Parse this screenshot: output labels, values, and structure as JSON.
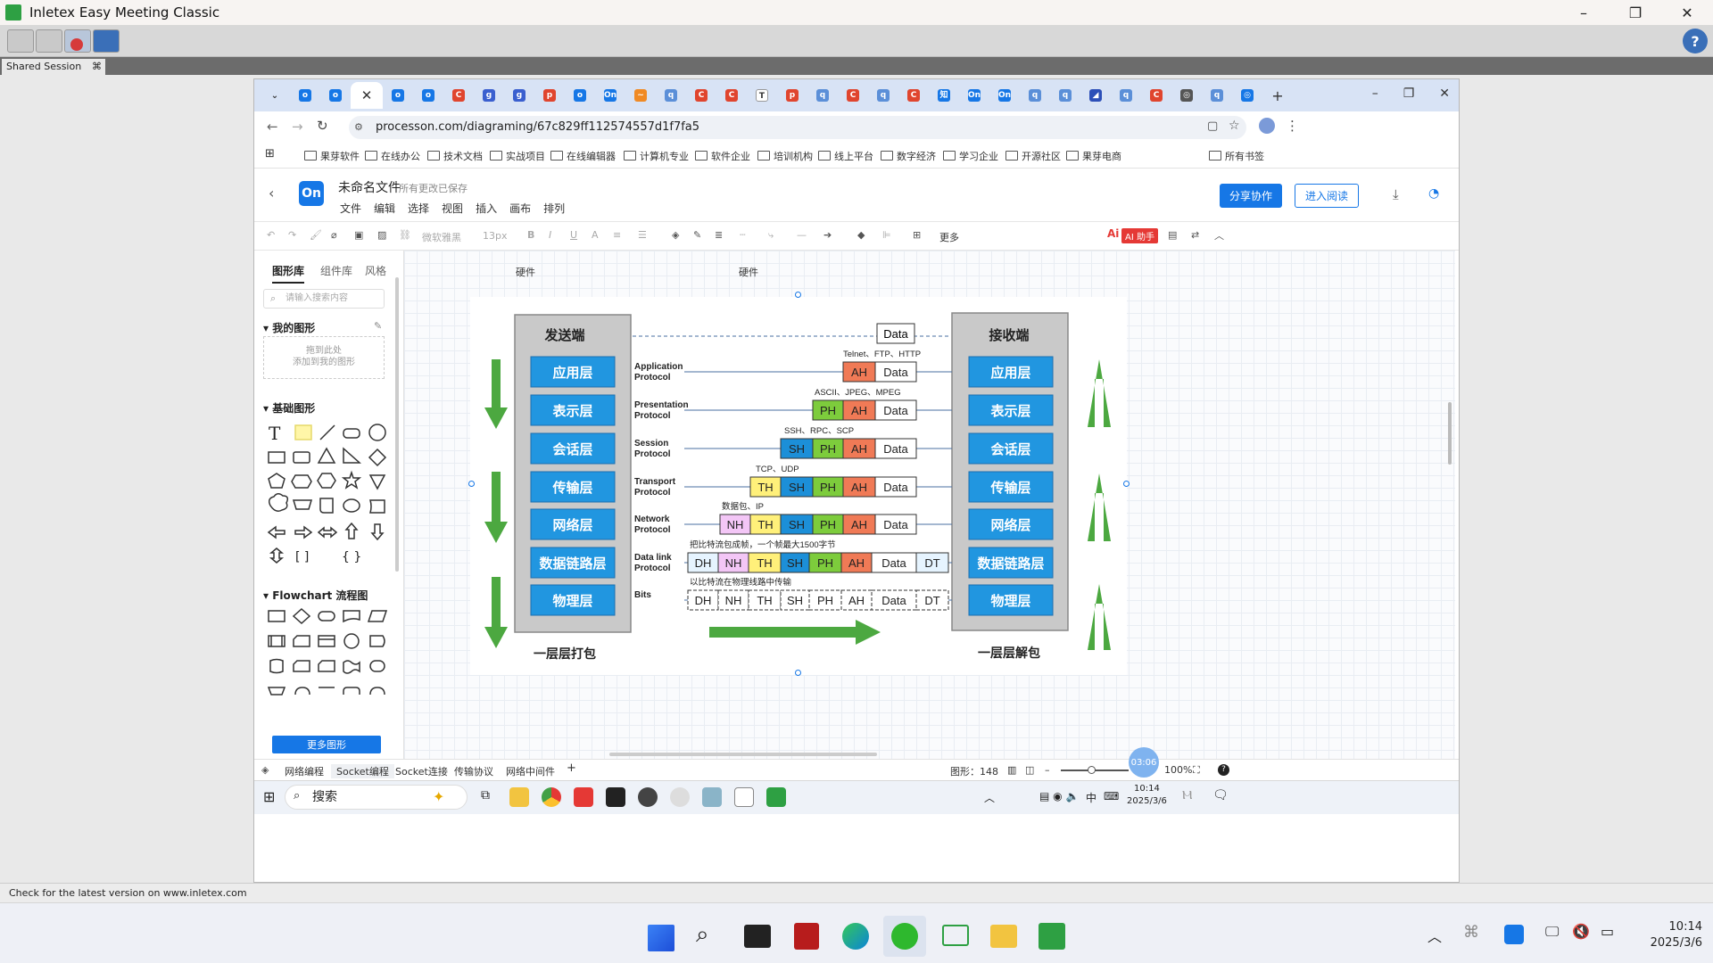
{
  "outer_window": {
    "title": "Inletex Easy Meeting Classic",
    "minimize": "–",
    "maximize": "❐",
    "close": "✕",
    "help": "?"
  },
  "session": {
    "tab_label": "Shared Session",
    "close": "⌘"
  },
  "status_line": "Check for the latest version on www.inletex.com",
  "browser": {
    "url": "processon.com/diagraming/67c829ff112574557d1f7fa5",
    "new_tab": "+",
    "bookmarks": [
      "果芽软件",
      "在线办公",
      "技术文档",
      "实战项目",
      "在线编辑器",
      "计算机专业",
      "软件企业",
      "培训机构",
      "线上平台",
      "数字经济",
      "学习企业",
      "开源社区",
      "果芽电商"
    ],
    "all_bookmarks": "所有书签"
  },
  "app": {
    "logo": "On",
    "doc_name": "未命名文件",
    "save_status": "所有更改已保存",
    "menus": [
      "文件",
      "编辑",
      "选择",
      "视图",
      "插入",
      "画布",
      "排列"
    ],
    "share": "分享协作",
    "read": "进入阅读",
    "font": "微软雅黑",
    "font_size": "13px",
    "more": "更多",
    "ai_label": "AI 助手"
  },
  "sidebar": {
    "tabs": [
      "图形库",
      "组件库",
      "风格"
    ],
    "search_placeholder": "请输入搜索内容",
    "my_shapes": "我的图形",
    "drop_hint_1": "拖到此处",
    "drop_hint_2": "添加到我的图形",
    "basic_shapes": "基础图形",
    "flowchart": "Flowchart 流程图",
    "more_shapes": "更多图形"
  },
  "canvas": {
    "hw_left": "硬件",
    "hw_right": "硬件"
  },
  "diagram": {
    "sender": "发送端",
    "receiver": "接收端",
    "pack": "一层层打包",
    "unpack": "一层层解包",
    "layers": [
      "应用层",
      "表示层",
      "会话层",
      "传输层",
      "网络层",
      "数据链路层",
      "物理层"
    ],
    "protocols": [
      [
        "Application",
        "Protocol"
      ],
      [
        "Presentation",
        "Protocol"
      ],
      [
        "Session",
        "Protocol"
      ],
      [
        "Transport",
        "Protocol"
      ],
      [
        "Network",
        "Protocol"
      ],
      [
        "Data link",
        "Protocol"
      ],
      [
        "Bits",
        ""
      ]
    ],
    "notes": [
      "Telnet、FTP、HTTP",
      "ASCII、JPEG、MPEG",
      "SSH、RPC、SCP",
      "TCP、UDP",
      "数据包、IP",
      "把比特流包成帧，一个帧最大1500字节",
      "以比特流在物理线路中传输"
    ],
    "top_data": "Data",
    "headers": {
      "AH": "AH",
      "PH": "PH",
      "SH": "SH",
      "TH": "TH",
      "NH": "NH",
      "DH": "DH",
      "DT": "DT",
      "Data": "Data"
    },
    "colors": {
      "AH": "#f07a56",
      "PH": "#7dcc3c",
      "SH": "#1c8fd8",
      "TH": "#fff07a",
      "NH": "#f3c6f6",
      "DH": "#e6f4ff",
      "DT": "#e6f4ff",
      "layer": "#2196e0",
      "arrow": "#4ca840"
    }
  },
  "pages": {
    "tabs": [
      "网络编程",
      "Socket编程",
      "Socket连接",
      "传输协议",
      "网络中间件"
    ],
    "active": 1,
    "add": "+",
    "shape_count": "图形：148",
    "zoom": "100%",
    "timer": "03:06"
  },
  "remote_taskbar": {
    "search": "搜索",
    "ime": "中",
    "time": "10:14",
    "date": "2025/3/6"
  },
  "host_taskbar": {
    "time": "10:14",
    "date": "2025/3/6"
  }
}
